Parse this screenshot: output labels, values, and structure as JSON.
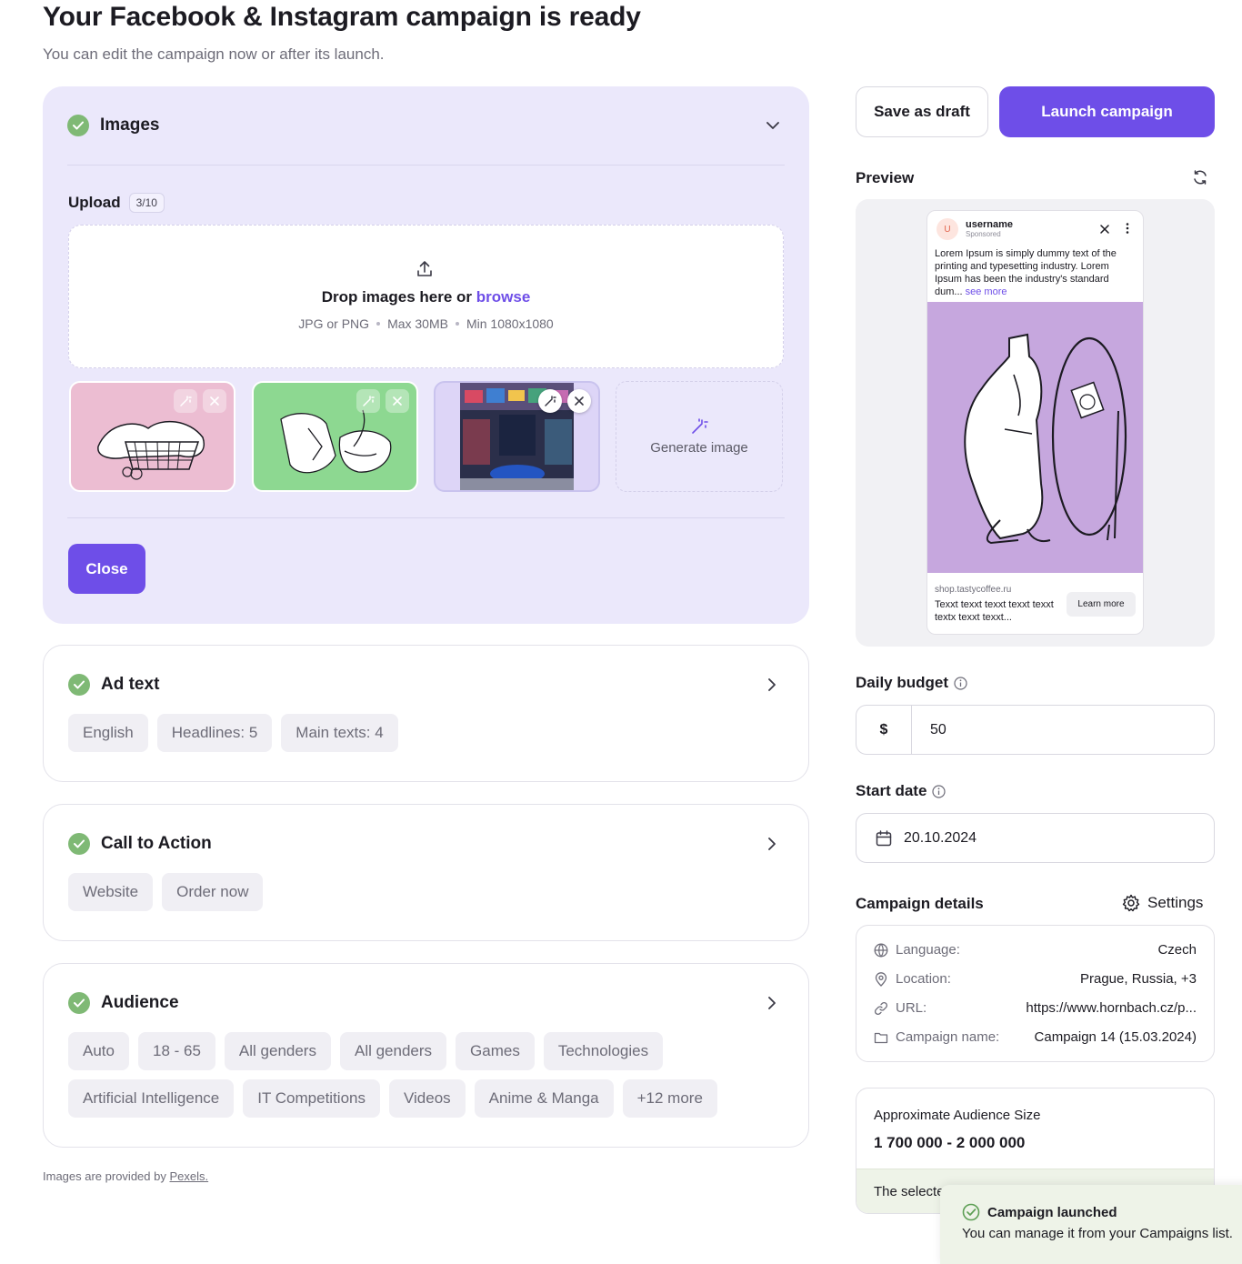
{
  "page": {
    "title": "Your Facebook & Instagram campaign is ready",
    "subtitle": "You can edit the campaign now or after its launch."
  },
  "images_section": {
    "title": "Images",
    "upload_label": "Upload",
    "upload_count": "3/10",
    "drop_text": "Drop images here or",
    "browse_label": "browse",
    "formats": "JPG or PNG",
    "max_size": "Max 30MB",
    "min_resolution": "Min 1080x1080",
    "generate_label": "Generate image",
    "close_label": "Close"
  },
  "ad_text_section": {
    "title": "Ad text",
    "chips": [
      "English",
      "Headlines: 5",
      "Main texts: 4"
    ]
  },
  "cta_section": {
    "title": "Call to Action",
    "chips": [
      "Website",
      "Order now"
    ]
  },
  "audience_section": {
    "title": "Audience",
    "chips": [
      "Auto",
      "18 - 65",
      "All genders",
      "All genders",
      "Games",
      "Technologies",
      "Artificial Intelligence",
      "IT Competitions",
      "Videos",
      "Anime & Manga",
      "+12 more"
    ]
  },
  "footer": {
    "note": "Images are provided by",
    "link": "Pexels."
  },
  "actions": {
    "save_draft": "Save as draft",
    "launch": "Launch campaign"
  },
  "preview": {
    "label": "Preview",
    "avatar_letter": "U",
    "username": "username",
    "sponsored": "Sponsored",
    "body": "Lorem Ipsum is simply dummy text of the printing and typesetting industry. Lorem Ipsum has been the industry's standard dum...",
    "see_more": "see more",
    "url": "shop.tastycoffee.ru",
    "description": "Texxt texxt texxt texxt texxt textx texxt texxt...",
    "cta": "Learn more"
  },
  "budget": {
    "label": "Daily budget",
    "currency": "$",
    "value": "50"
  },
  "start_date": {
    "label": "Start date",
    "value": "20.10.2024"
  },
  "campaign_details": {
    "label": "Campaign details",
    "settings": "Settings",
    "rows": [
      {
        "key": "Language:",
        "value": "Czech"
      },
      {
        "key": "Location:",
        "value": "Prague, Russia, +3"
      },
      {
        "key": "URL:",
        "value": "https://www.hornbach.cz/p..."
      },
      {
        "key": "Campaign name:",
        "value": "Campaign 14 (15.03.2024)"
      }
    ]
  },
  "audience_size": {
    "label": "Approximate Audience Size",
    "value": "1 700 000 - 2 000 000",
    "note": "The selecte"
  },
  "toast": {
    "title": "Campaign launched",
    "message": "You can manage it from your Campaigns list."
  },
  "colors": {
    "accent": "#6e4ee8",
    "success": "#7fb975",
    "open_card_bg": "#ebe8fb"
  }
}
